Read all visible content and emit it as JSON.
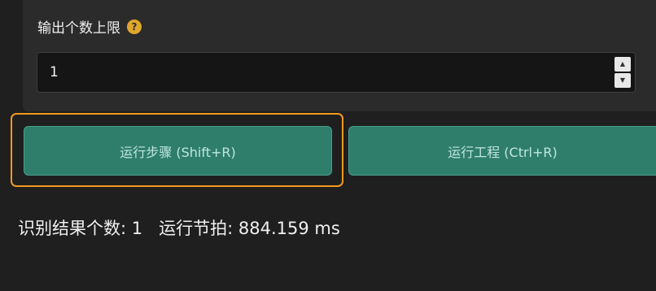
{
  "output_limit": {
    "label": "输出个数上限",
    "help_icon": "question-circle-icon",
    "help_glyph": "?",
    "value": "1",
    "up_glyph": "▲",
    "down_glyph": "▼"
  },
  "buttons": {
    "run_step": "运行步骤 (Shift+R)",
    "run_project": "运行工程 (Ctrl+R)"
  },
  "status": {
    "count": "识别结果个数: 1",
    "cycle_time": "运行节拍: 884.159 ms"
  },
  "colors": {
    "background": "#1f1f1f",
    "panel": "#2b2b2b",
    "button": "#2f7e6c",
    "highlight": "#f39a1b",
    "help_icon": "#e0a72a"
  }
}
